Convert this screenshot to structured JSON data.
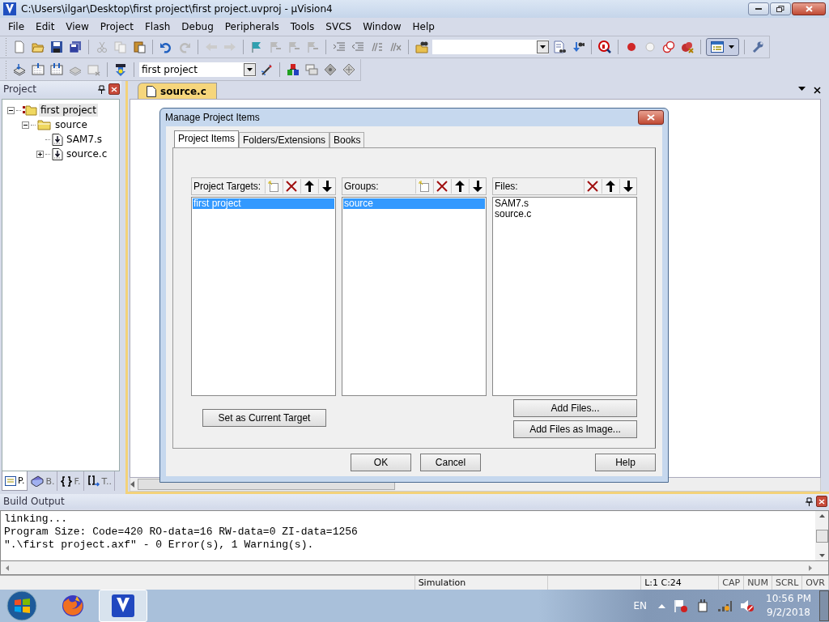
{
  "window": {
    "title": "C:\\Users\\ilgar\\Desktop\\first project\\first project.uvproj - µVision4"
  },
  "menu": [
    "File",
    "Edit",
    "View",
    "Project",
    "Flash",
    "Debug",
    "Peripherals",
    "Tools",
    "SVCS",
    "Window",
    "Help"
  ],
  "toolbar": {
    "target_combo": {
      "value": "first project"
    }
  },
  "project_panel": {
    "title": "Project",
    "tree": [
      {
        "label": "first project",
        "kind": "target",
        "expanded": true,
        "selected": true,
        "children": [
          {
            "label": "source",
            "kind": "group",
            "expanded": true,
            "selected": false,
            "children": [
              {
                "label": "SAM7.s",
                "kind": "file",
                "selected": false
              },
              {
                "label": "source.c",
                "kind": "file",
                "expanded": false,
                "selected": false
              }
            ]
          }
        ]
      }
    ],
    "tabs": [
      {
        "label": "P.",
        "kind": "project",
        "selected": true
      },
      {
        "label": "B.",
        "kind": "books",
        "selected": false
      },
      {
        "label": "F.",
        "kind": "functions",
        "selected": false
      },
      {
        "label": "T..",
        "kind": "templates",
        "selected": false
      }
    ]
  },
  "editor_tabs": [
    {
      "label": "source.c",
      "selected": true
    }
  ],
  "dialog": {
    "title": "Manage Project Items",
    "tabs": [
      {
        "label": "Project Items",
        "selected": true
      },
      {
        "label": "Folders/Extensions",
        "selected": false
      },
      {
        "label": "Books",
        "selected": false
      }
    ],
    "lists": [
      {
        "title": "Project Targets:",
        "kind": "addable",
        "items": [
          {
            "label": "first project",
            "selected": true
          }
        ]
      },
      {
        "title": "Groups:",
        "kind": "addable",
        "items": [
          {
            "label": "source",
            "selected": true
          }
        ]
      },
      {
        "title": "Files:",
        "kind": "fixed",
        "items": [
          {
            "label": "SAM7.s",
            "selected": false
          },
          {
            "label": "source.c",
            "selected": false
          }
        ]
      }
    ],
    "set_target_button": "Set as Current Target",
    "add_buttons": [
      "Add Files...",
      "Add Files as Image..."
    ],
    "buttons": [
      "OK",
      "Cancel",
      "Help"
    ]
  },
  "build_output": {
    "title": "Build Output",
    "lines": [
      "linking...",
      "Program Size: Code=420 RO-data=16 RW-data=0 ZI-data=1256",
      "\".\\first project.axf\" - 0 Error(s), 1 Warning(s)."
    ]
  },
  "status_bar": {
    "mode": "Simulation",
    "position": "L:1 C:24",
    "indicators": [
      "CAP",
      "NUM",
      "SCRL",
      "OVR"
    ]
  },
  "taskbar": {
    "apps": [
      {
        "kind": "firefox",
        "selected": false
      },
      {
        "kind": "uvision",
        "selected": true
      }
    ],
    "language": "EN",
    "time": "10:56 PM",
    "date": "9/2/2018"
  }
}
